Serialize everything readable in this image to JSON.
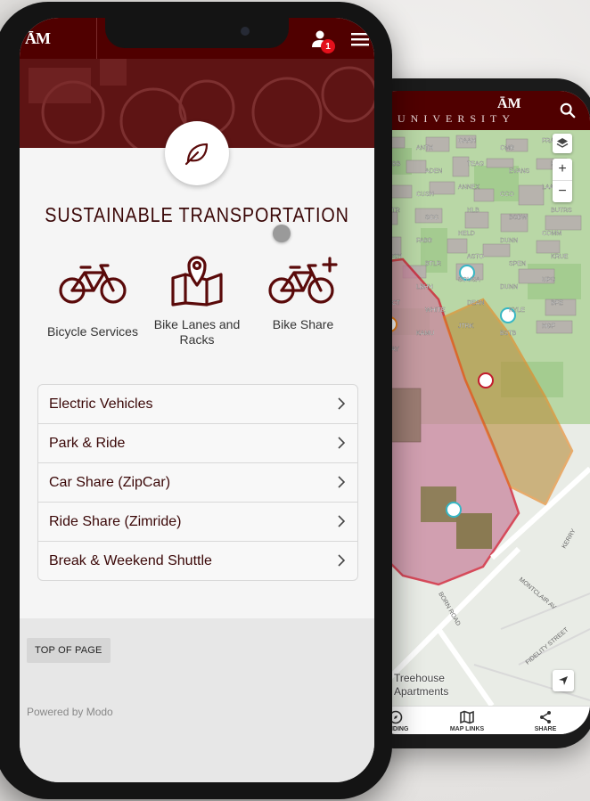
{
  "back_phone": {
    "header": {
      "university_text": "UNIVERSITY",
      "logo_text": "ĀM"
    },
    "map": {
      "labels": [
        "HEM",
        "ANTH",
        "OAAH",
        "OMB",
        "FRAN",
        "HUBB",
        "ADEN",
        "TEAG",
        "EVANS",
        "PAV",
        "HECC",
        "CUSH",
        "ANNEX",
        "CCO",
        "LAAH",
        "PETR",
        "SCC",
        "HLB",
        "BSBW",
        "BUTRS",
        "REED",
        "FABB",
        "HELD",
        "DUNN",
        "COMM",
        "MOSH",
        "BTLR",
        "ASTO",
        "SPEN",
        "KRUE",
        "MLS",
        "LBHH",
        "SOUSA",
        "DUNN",
        "UPG",
        "SCCT",
        "WHITE",
        "DEAN",
        "KYLE",
        "BFE",
        "PDCK",
        "KAMU",
        "JTRK",
        "BSTB",
        "HGF",
        "CLAY",
        "BORN ROAD",
        "MONTCLAIR AV",
        "FIDELITY STREET",
        "KERRY"
      ],
      "place_label": "Treehouse Apartments"
    },
    "bottom_bar": [
      {
        "label": "FINDING",
        "icon": "compass-icon"
      },
      {
        "label": "MAP LINKS",
        "icon": "map-icon"
      },
      {
        "label": "SHARE",
        "icon": "share-icon"
      }
    ]
  },
  "front_phone": {
    "header": {
      "logo": "ĀM",
      "notification_count": "1"
    },
    "page_title": "SUSTAINABLE TRANSPORTATION",
    "services": [
      {
        "label": "Bicycle Services",
        "icon": "bicycle-icon"
      },
      {
        "label": "Bike Lanes and Racks",
        "icon": "map-pin-icon"
      },
      {
        "label": "Bike Share",
        "icon": "bike-share-icon"
      }
    ],
    "list": [
      {
        "label": "Electric Vehicles"
      },
      {
        "label": "Park & Ride"
      },
      {
        "label": "Car Share (ZipCar)"
      },
      {
        "label": "Ride Share (Zimride)"
      },
      {
        "label": "Break & Weekend Shuttle"
      }
    ],
    "top_button": "TOP OF PAGE",
    "powered_by": "Powered by Modo"
  },
  "colors": {
    "maroon": "#500000",
    "title": "#3a0707",
    "icon": "#5a0a0a"
  }
}
